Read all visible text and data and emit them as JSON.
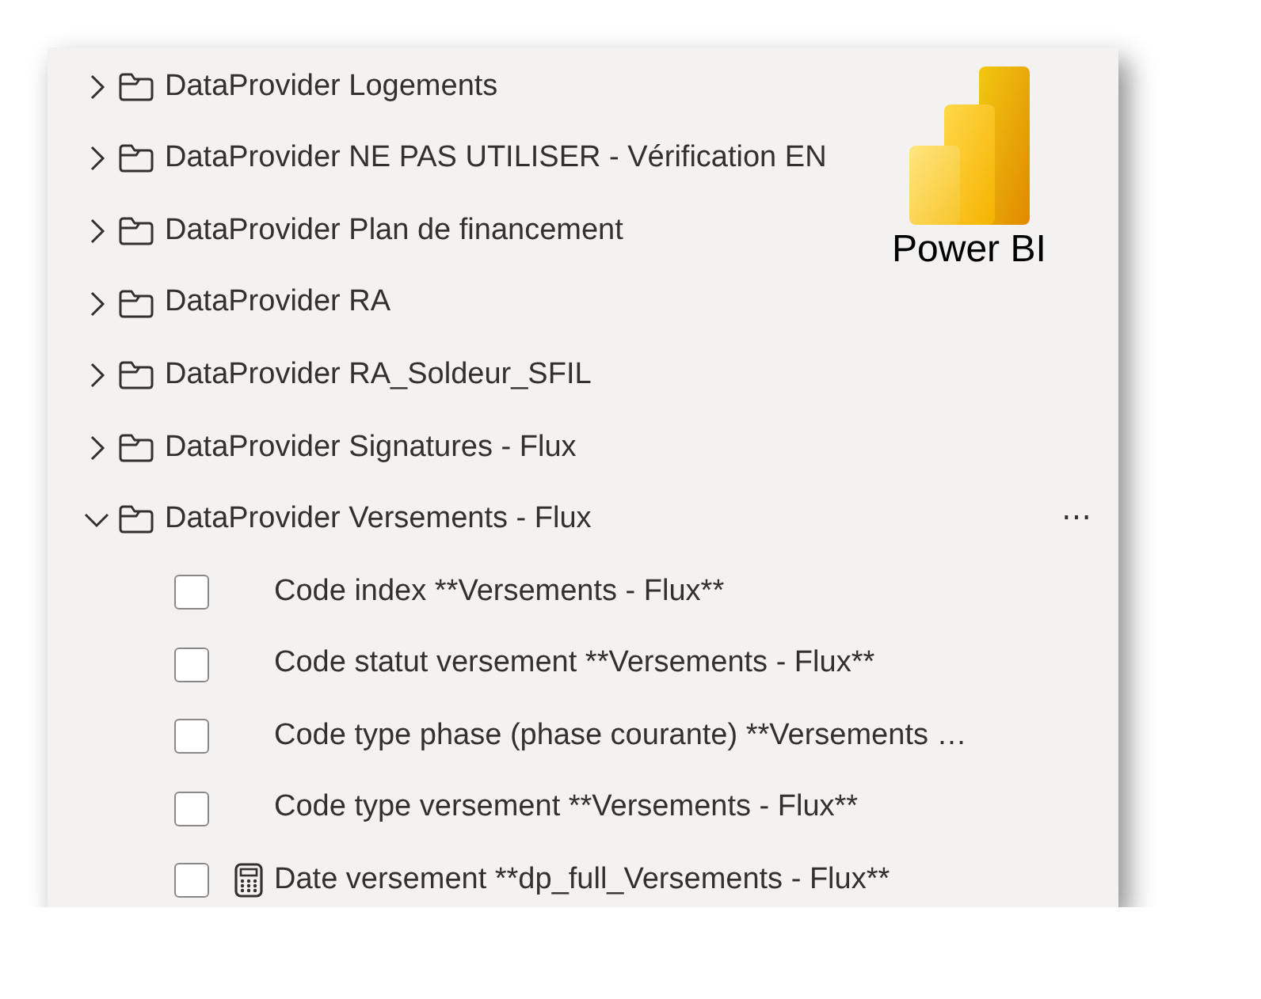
{
  "folders": [
    {
      "name": "DataProvider Logements",
      "expanded": false
    },
    {
      "name": "DataProvider NE PAS UTILISER - Vérification EN",
      "expanded": false
    },
    {
      "name": "DataProvider Plan de financement",
      "expanded": false
    },
    {
      "name": "DataProvider RA",
      "expanded": false
    },
    {
      "name": "DataProvider RA_Soldeur_SFIL",
      "expanded": false
    },
    {
      "name": "DataProvider Signatures - Flux",
      "expanded": false
    },
    {
      "name": "DataProvider Versements - Flux",
      "expanded": true,
      "more": "⋯",
      "children": [
        {
          "name": "Code index **Versements - Flux**",
          "kind": "column",
          "checked": false
        },
        {
          "name": "Code statut versement **Versements - Flux**",
          "kind": "column",
          "checked": false
        },
        {
          "name": "Code type phase (phase courante) **Versements …",
          "kind": "column",
          "checked": false
        },
        {
          "name": "Code type versement **Versements - Flux**",
          "kind": "column",
          "checked": false
        },
        {
          "name": "Date versement **dp_full_Versements - Flux**",
          "kind": "calculated",
          "checked": false
        }
      ]
    }
  ],
  "logo": {
    "label": "Power BI"
  }
}
